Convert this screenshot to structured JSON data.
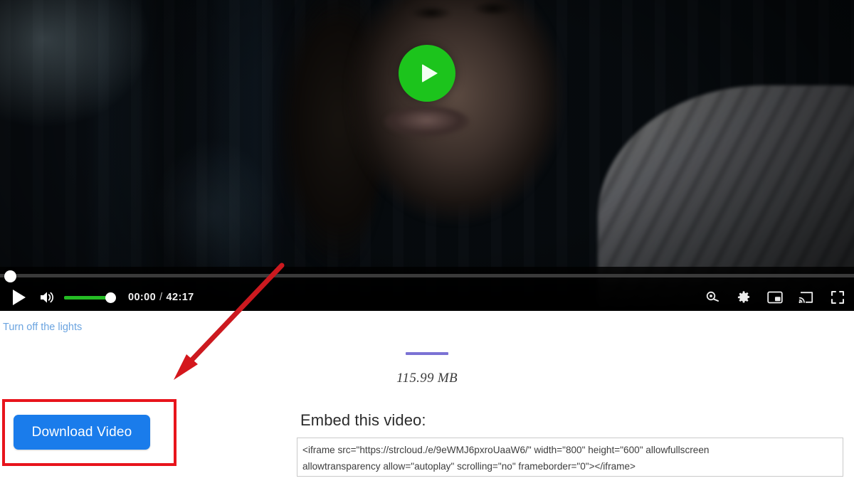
{
  "player": {
    "play_overlay_icon": "play-circle-icon",
    "controls": {
      "play_icon": "play-icon",
      "volume_icon": "volume-icon",
      "current_time": "00:00",
      "time_separator": "/",
      "duration": "42:17",
      "volume_level_percent": 100,
      "progress_percent": 0,
      "right_icons": [
        {
          "name": "zoom-search-icon",
          "label": "Search"
        },
        {
          "name": "gear-icon",
          "label": "Settings"
        },
        {
          "name": "picture-in-picture-icon",
          "label": "Picture in picture"
        },
        {
          "name": "cast-icon",
          "label": "Cast"
        },
        {
          "name": "fullscreen-icon",
          "label": "Fullscreen"
        }
      ]
    }
  },
  "page": {
    "turn_off_lights_label": "Turn off the lights",
    "file_size": "115.99 MB",
    "download_button_label": "Download Video",
    "embed_title": "Embed this video:",
    "embed_code": "<iframe src=\"https://strcloud./e/9eWMJ6pxroUaaW6/\" width=\"800\" height=\"600\" allowfullscreen\nallowtransparency allow=\"autoplay\" scrolling=\"no\" frameborder=\"0\"></iframe>"
  },
  "annotations": {
    "arrow": {
      "name": "red-arrow-annotation",
      "color": "#d4171c"
    },
    "box": {
      "name": "red-highlight-box-annotation",
      "color": "#e8141c"
    }
  },
  "colors": {
    "play_overlay_green": "#1cc41c",
    "volume_green": "#24bb24",
    "download_blue": "#1a7ceb",
    "link_blue": "#6ba4e0",
    "divider_purple": "#7b72d4",
    "annotation_red": "#e8141c"
  }
}
